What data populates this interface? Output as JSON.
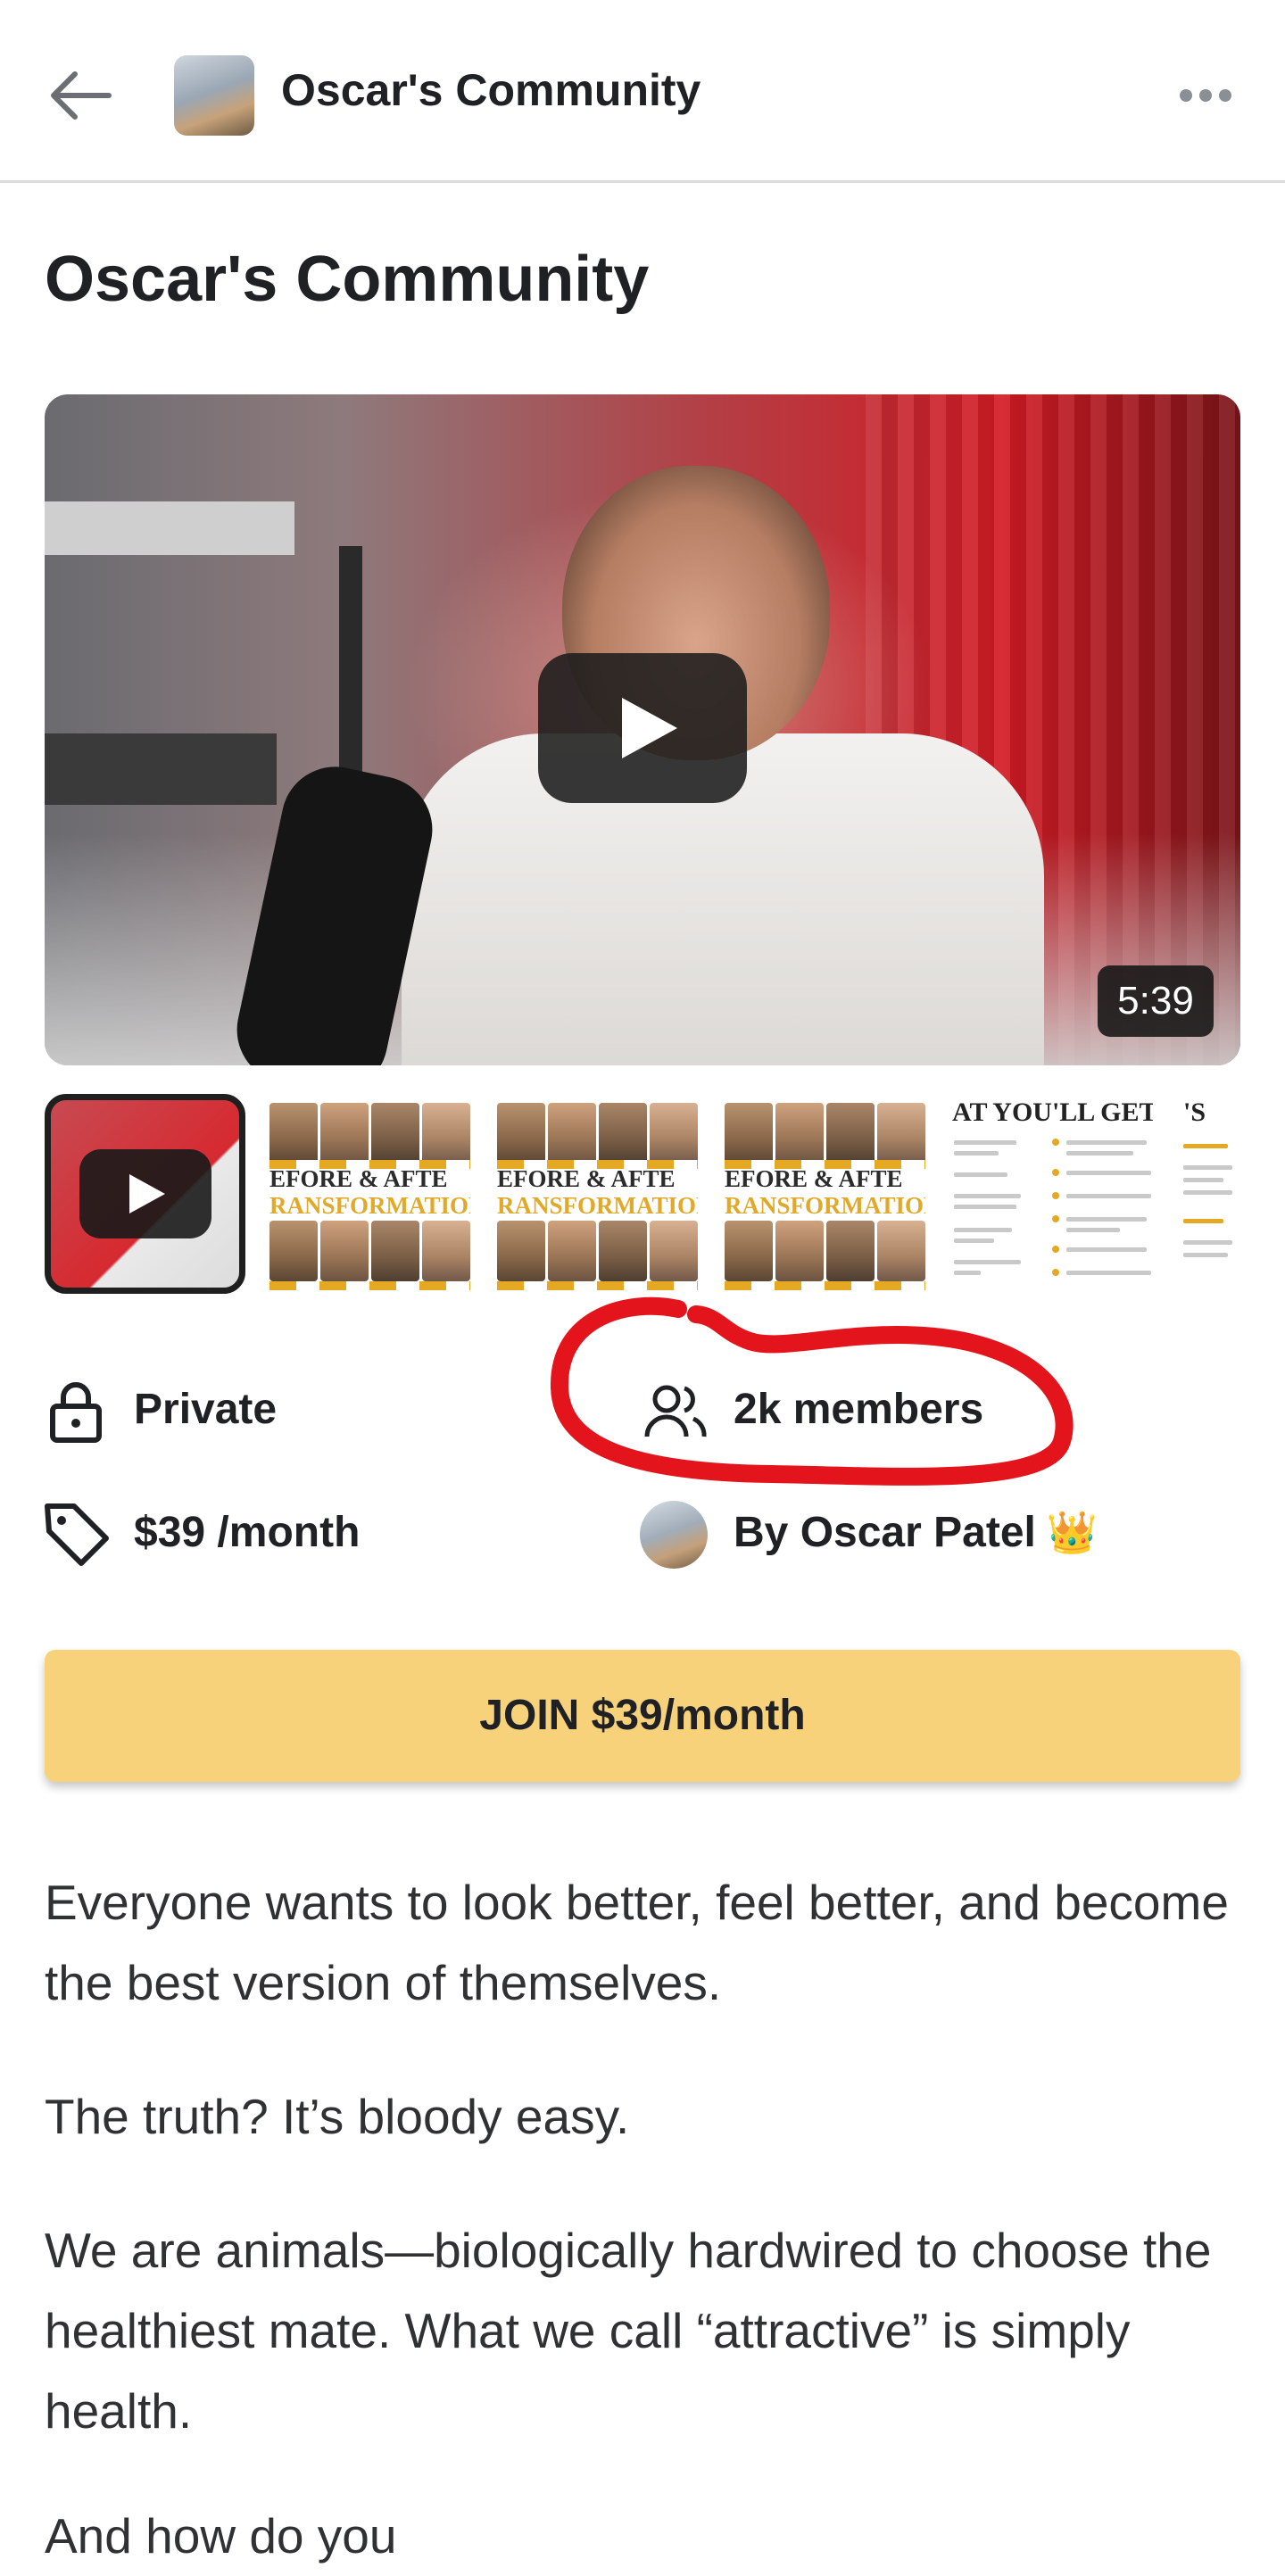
{
  "header": {
    "title": "Oscar's Community",
    "back_icon": "arrow-left-icon",
    "more_icon": "more-horizontal-icon"
  },
  "page": {
    "title": "Oscar's Community"
  },
  "video": {
    "duration": "5:39"
  },
  "thumbnails": {
    "before_after_label_1": "EFORE & AFTE",
    "before_after_label_2": "RANSFORMATION",
    "what_you_get_title": "AT YOU'LL GET..",
    "partial_title": "'S"
  },
  "info": {
    "privacy": "Private",
    "members": "2k members",
    "price": "$39 /month",
    "owner": "By Oscar Patel",
    "owner_badge": "👑"
  },
  "join_button": {
    "label": "JOIN $39/month"
  },
  "description": {
    "p1": "Everyone wants to look better, feel better, and become the best version of themselves.",
    "p2": "The truth? It’s bloody easy.",
    "p3": "We are animals—biologically hardwired to choose the healthiest mate. What we call “attractive” is simply health.",
    "p4": "And how do you"
  },
  "colors": {
    "join_button": "#f8d27b",
    "annotation": "#e3141b",
    "text": "#202124"
  }
}
